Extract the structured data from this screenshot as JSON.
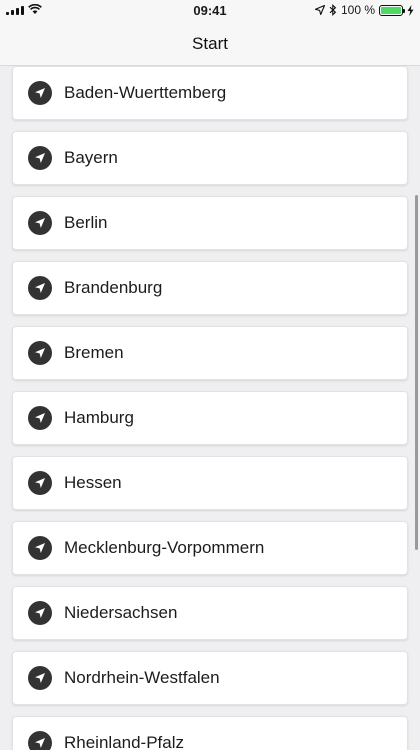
{
  "status_bar": {
    "time": "09:41",
    "battery_text": "100 %",
    "battery_fill": 1.0
  },
  "nav": {
    "title": "Start"
  },
  "list": {
    "items": [
      {
        "label": "Baden-Wuerttemberg",
        "icon": "navigation-arrow-icon"
      },
      {
        "label": "Bayern",
        "icon": "navigation-arrow-icon"
      },
      {
        "label": "Berlin",
        "icon": "navigation-arrow-icon"
      },
      {
        "label": "Brandenburg",
        "icon": "navigation-arrow-icon"
      },
      {
        "label": "Bremen",
        "icon": "navigation-arrow-icon"
      },
      {
        "label": "Hamburg",
        "icon": "navigation-arrow-icon"
      },
      {
        "label": "Hessen",
        "icon": "navigation-arrow-icon"
      },
      {
        "label": "Mecklenburg-Vorpommern",
        "icon": "navigation-arrow-icon"
      },
      {
        "label": "Niedersachsen",
        "icon": "navigation-arrow-icon"
      },
      {
        "label": "Nordrhein-Westfalen",
        "icon": "navigation-arrow-icon"
      },
      {
        "label": "Rheinland-Pfalz",
        "icon": "navigation-arrow-icon"
      }
    ]
  },
  "colors": {
    "icon_circle": "#333333",
    "battery_green": "#4cd964"
  }
}
